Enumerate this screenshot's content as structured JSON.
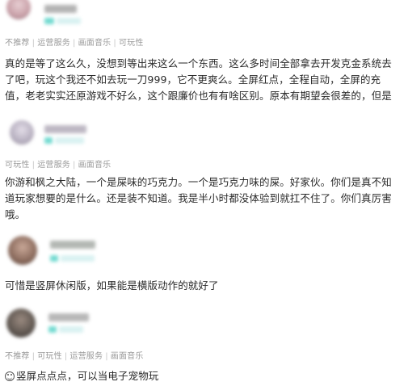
{
  "reviews": [
    {
      "tags": [
        "不推荐",
        "运营服务",
        "画面音乐",
        "可玩性"
      ],
      "text": "真的是等了这么久，没想到等出来这么一个东西。这么多时间全部拿去开发克金系统去了吧，玩这个我还不如去玩一刀999，它不更爽么。全屏红点，全程自动，全屏的充值，老老实实还原游戏不好么，这个跟廉价也有有啥区别。原本有期望会很差的，但是",
      "avatar_color": "#c9a0a8"
    },
    {
      "tags": [
        "可玩性",
        "运营服务",
        "画面音乐"
      ],
      "text": "你游和枫之大陆，一个是屎味的巧克力。一个是巧克力味的屎。好家伙。你们是真不知道玩家想要的是什么。还是装不知道。我是半小时都没体验到就扛不住了。你们真厉害哦。",
      "avatar_color": "#b7b0c0"
    },
    {
      "tags": [],
      "text": "可惜是竖屏休闲版，如果能是横版动作的就好了",
      "avatar_color": "#8a6a5c"
    },
    {
      "tags": [
        "不推荐",
        "可玩性",
        "运营服务",
        "画面音乐"
      ],
      "text": "竖屏点点点，可以当电子宠物玩",
      "avatar_color": "#5e5650"
    }
  ],
  "colors": {
    "badge_teal": "#4fd1c5",
    "tag_gray": "#9a9a9a"
  }
}
